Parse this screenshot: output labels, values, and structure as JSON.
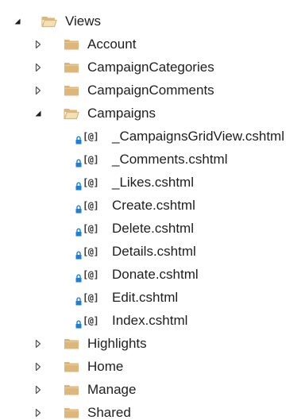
{
  "colors": {
    "folder": "#dcb67a",
    "folder_open_back": "#dcb67a",
    "folder_open_front": "#f4e0b0",
    "expander_open": "#1e1e1e",
    "expander_closed": "#555555",
    "lock": "#1e7fd6",
    "text": "#1e1e1e"
  },
  "tree": [
    {
      "label": "Views",
      "kind": "folder",
      "state": "expanded",
      "depth": 0,
      "name": "views"
    },
    {
      "label": "Account",
      "kind": "folder",
      "state": "collapsed",
      "depth": 1,
      "name": "account"
    },
    {
      "label": "CampaignCategories",
      "kind": "folder",
      "state": "collapsed",
      "depth": 1,
      "name": "campaigncategories"
    },
    {
      "label": "CampaignComments",
      "kind": "folder",
      "state": "collapsed",
      "depth": 1,
      "name": "campaigncomments"
    },
    {
      "label": "Campaigns",
      "kind": "folder",
      "state": "expanded",
      "depth": 1,
      "name": "campaigns"
    },
    {
      "label": "_CampaignsGridView.cshtml",
      "kind": "file",
      "icon": "locked-razor-file-icon",
      "depth": 2,
      "name": "campaignsgridview"
    },
    {
      "label": "_Comments.cshtml",
      "kind": "file",
      "icon": "locked-razor-file-icon",
      "depth": 2,
      "name": "comments"
    },
    {
      "label": "_Likes.cshtml",
      "kind": "file",
      "icon": "locked-razor-file-icon",
      "depth": 2,
      "name": "likes"
    },
    {
      "label": "Create.cshtml",
      "kind": "file",
      "icon": "locked-razor-file-icon",
      "depth": 2,
      "name": "create"
    },
    {
      "label": "Delete.cshtml",
      "kind": "file",
      "icon": "locked-razor-file-icon",
      "depth": 2,
      "name": "delete"
    },
    {
      "label": "Details.cshtml",
      "kind": "file",
      "icon": "locked-razor-file-icon",
      "depth": 2,
      "name": "details"
    },
    {
      "label": "Donate.cshtml",
      "kind": "file",
      "icon": "locked-razor-file-icon",
      "depth": 2,
      "name": "donate"
    },
    {
      "label": "Edit.cshtml",
      "kind": "file",
      "icon": "locked-razor-file-icon",
      "depth": 2,
      "name": "edit"
    },
    {
      "label": "Index.cshtml",
      "kind": "file",
      "icon": "locked-razor-file-icon",
      "depth": 2,
      "name": "index"
    },
    {
      "label": "Highlights",
      "kind": "folder",
      "state": "collapsed",
      "depth": 1,
      "name": "highlights"
    },
    {
      "label": "Home",
      "kind": "folder",
      "state": "collapsed",
      "depth": 1,
      "name": "home"
    },
    {
      "label": "Manage",
      "kind": "folder",
      "state": "collapsed",
      "depth": 1,
      "name": "manage"
    },
    {
      "label": "Shared",
      "kind": "folder",
      "state": "collapsed",
      "depth": 1,
      "name": "shared"
    }
  ],
  "razor_glyph": "[@]"
}
